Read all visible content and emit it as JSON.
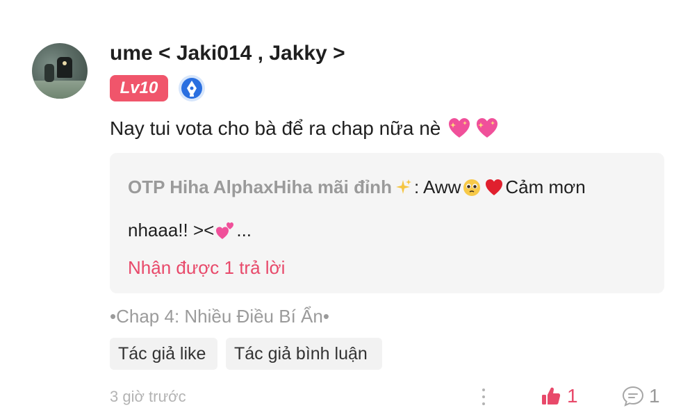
{
  "comment": {
    "username": "ume < Jaki014 , Jakky >",
    "level": "Lv10",
    "text": "Nay tui vota cho bà để ra chap nữa nè",
    "reply": {
      "author": "OTP Hiha AlphaxHiha mãi đỉnh",
      "text_line1": ": Aww",
      "text_after": "Cảm mơn",
      "text_line2": "nhaaa!! ><",
      "ellipsis": "...",
      "count_label": "Nhận được 1 trả lời"
    },
    "chapter": "•Chap 4: Nhiều Điều Bí Ẩn•",
    "tags": [
      "Tác giả like",
      "Tác giả bình luận"
    ],
    "time": "3 giờ trước",
    "likes": "1",
    "replies": "1"
  },
  "colors": {
    "accent": "#e8496a",
    "level_badge": "#f0556b",
    "author_badge": "#2a6fe0",
    "reply_bg": "#f5f5f5"
  },
  "icons": {
    "emoji_heart": "sparkling-heart-icon",
    "emoji_sparkles": "sparkles-icon",
    "emoji_pleading": "pleading-face-icon",
    "emoji_red_heart": "red-heart-icon",
    "emoji_two_hearts": "two-hearts-icon",
    "like": "thumbs-up-icon",
    "reply": "comment-bubble-icon",
    "more": "vertical-dots-icon",
    "author": "pen-nib-badge-icon"
  }
}
